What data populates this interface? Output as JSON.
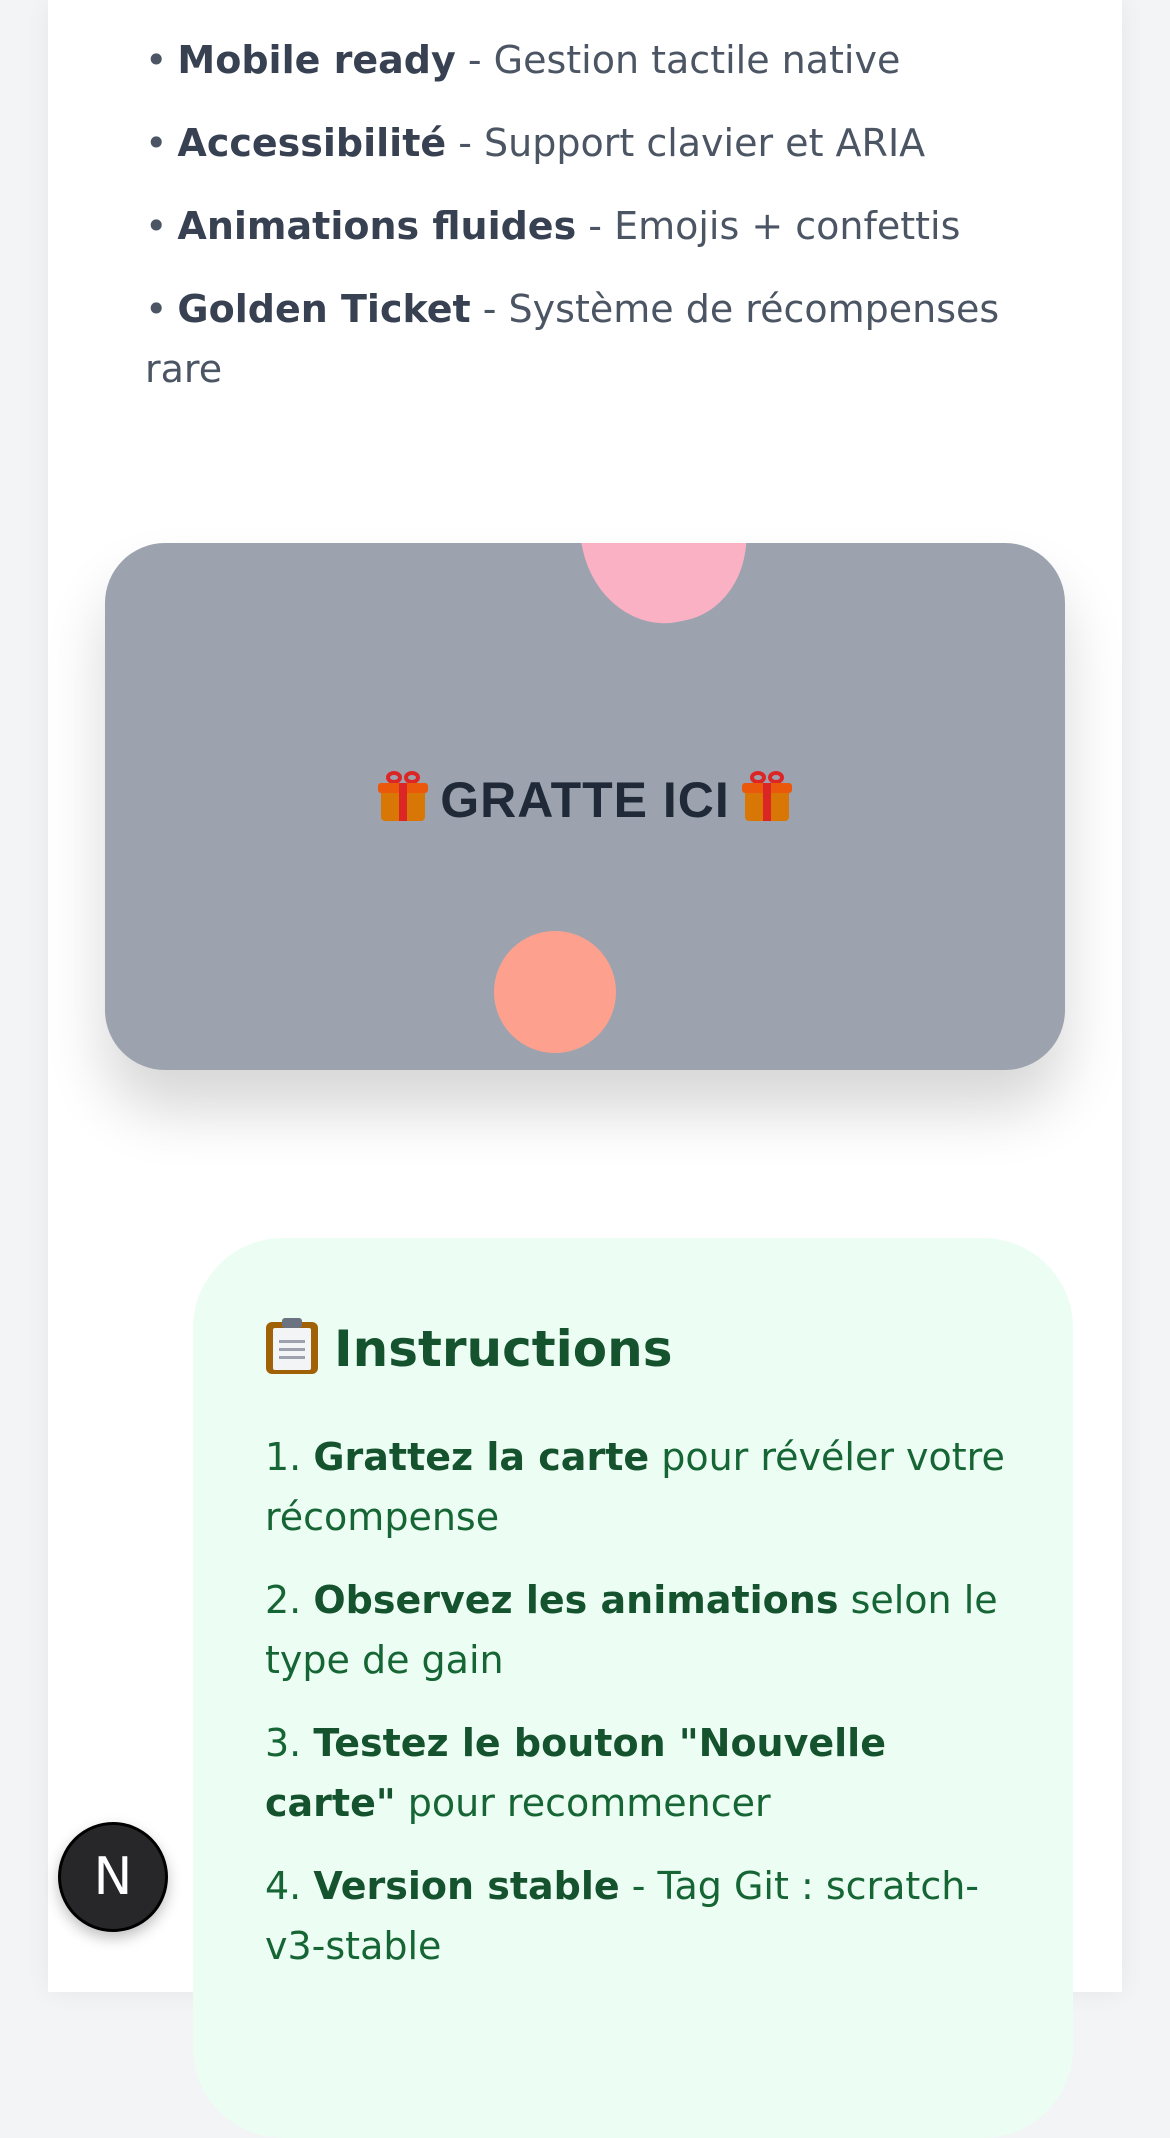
{
  "features": [
    {
      "title": "Mobile ready",
      "desc": "- Gestion tactile native"
    },
    {
      "title": "Accessibilité",
      "desc": "- Support clavier et ARIA"
    },
    {
      "title": "Animations fluides",
      "desc": "- Emojis + confettis"
    },
    {
      "title": "Golden Ticket",
      "desc": "- Système de récompenses rare"
    }
  ],
  "bullet": "•",
  "scratch_card": {
    "label": "GRATTE ICI",
    "icon": "gift-icon",
    "color": "#9ca3af"
  },
  "instructions": {
    "title": "Instructions",
    "icon": "clipboard-icon",
    "steps": [
      {
        "num": "1.",
        "bold": "Grattez la carte",
        "rest": "pour révéler votre récompense"
      },
      {
        "num": "2.",
        "bold": "Observez les animations",
        "rest": "selon le type de gain"
      },
      {
        "num": "3.",
        "bold": "Testez le bouton \"Nouvelle carte\"",
        "rest": "pour recommencer"
      },
      {
        "num": "4.",
        "bold": "Version stable",
        "rest": "- Tag Git : scratch-v3-stable"
      }
    ]
  },
  "dev_badge": {
    "letter": "N"
  }
}
